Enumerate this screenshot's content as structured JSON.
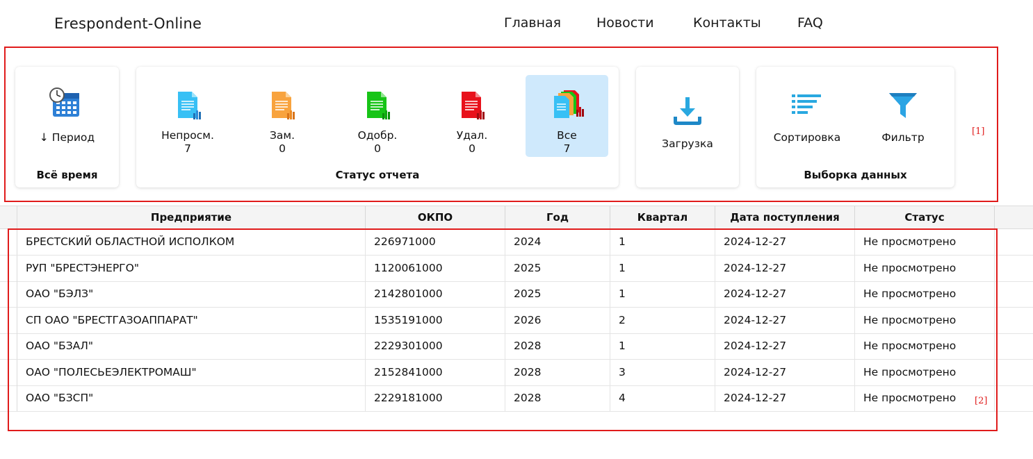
{
  "header": {
    "brand": "Erespondent-Online",
    "nav": [
      "Главная",
      "Новости",
      "Контакты",
      "FAQ"
    ]
  },
  "annotations": {
    "toolbar": "[1]",
    "table": "[2]"
  },
  "period_card": {
    "button_label": "↓ Период",
    "title": "Всё время"
  },
  "status_card": {
    "title": "Статус отчета",
    "items": [
      {
        "label": "Непросм.",
        "count": "7",
        "color": "#29b6f6"
      },
      {
        "label": "Зам.",
        "count": "0",
        "color": "#f7a23b"
      },
      {
        "label": "Одобр.",
        "count": "0",
        "color": "#1fc21f"
      },
      {
        "label": "Удал.",
        "count": "0",
        "color": "#e8111b"
      },
      {
        "label": "Все",
        "count": "7",
        "active": true
      }
    ]
  },
  "upload_card": {
    "label": "Загрузка"
  },
  "selection_card": {
    "title": "Выборка данных",
    "sort_label": "Сортировка",
    "filter_label": "Фильтр"
  },
  "table": {
    "columns": [
      "Предприятие",
      "ОКПО",
      "Год",
      "Квартал",
      "Дата поступления",
      "Статус"
    ],
    "rows": [
      [
        "БРЕСТСКИЙ ОБЛАСТНОЙ ИСПОЛКОМ",
        "226971000",
        "2024",
        "1",
        "2024-12-27",
        "Не просмотрено"
      ],
      [
        "РУП \"БРЕСТЭНЕРГО\"",
        "1120061000",
        "2025",
        "1",
        "2024-12-27",
        "Не просмотрено"
      ],
      [
        "ОАО \"БЭЛЗ\"",
        "2142801000",
        "2025",
        "1",
        "2024-12-27",
        "Не просмотрено"
      ],
      [
        "СП ОАО \"БРЕСТГАЗОАППАРАТ\"",
        "1535191000",
        "2026",
        "2",
        "2024-12-27",
        "Не просмотрено"
      ],
      [
        "ОАО \"БЗАЛ\"",
        "2229301000",
        "2028",
        "1",
        "2024-12-27",
        "Не просмотрено"
      ],
      [
        "ОАО \"ПОЛЕСЬЕЭЛЕКТРОМАШ\"",
        "2152841000",
        "2028",
        "3",
        "2024-12-27",
        "Не просмотрено"
      ],
      [
        "ОАО \"БЗСП\"",
        "2229181000",
        "2028",
        "4",
        "2024-12-27",
        "Не просмотрено"
      ]
    ]
  },
  "colors": {
    "accent": "#29a8e0",
    "annotation": "#e01b1b",
    "active_tab": "#cfe9fc"
  }
}
